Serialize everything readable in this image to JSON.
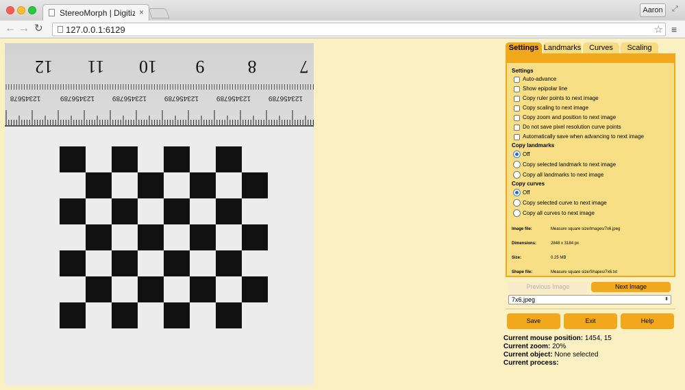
{
  "browser": {
    "tab_title": "StereoMorph | Digitizing A",
    "tab_close": "×",
    "user_label": "Aaron",
    "url": "127.0.0.1:6129",
    "back_glyph": "←",
    "forward_glyph": "→",
    "reload_glyph": "↻",
    "star_glyph": "☆",
    "menu_glyph": "≡",
    "fullscreen_glyph": "⤢"
  },
  "ruler": {
    "numbers": [
      "12",
      "11",
      "10",
      "9",
      "8",
      "7"
    ],
    "fine_labels": [
      "12345678",
      "123456789",
      "123456789",
      "123456789",
      "123456789",
      "123456789",
      "89"
    ]
  },
  "tabs": [
    {
      "label": "Settings",
      "active": true
    },
    {
      "label": "Landmarks",
      "active": false
    },
    {
      "label": "Curves",
      "active": false
    },
    {
      "label": "Scaling",
      "active": false
    }
  ],
  "settings": {
    "title": "Settings",
    "checkboxes": [
      "Auto-advance",
      "Show epipolar line",
      "Copy ruler points to next image",
      "Copy scaling to next image",
      "Copy zoom and position to next image",
      "Do not save pixel resolution curve points",
      "Automatically save when advancing to next image"
    ],
    "copy_landmarks_title": "Copy landmarks",
    "copy_landmarks": [
      {
        "label": "Off",
        "selected": true
      },
      {
        "label": "Copy selected landmark to next image",
        "selected": false
      },
      {
        "label": "Copy all landmarks to next image",
        "selected": false
      }
    ],
    "copy_curves_title": "Copy curves",
    "copy_curves": [
      {
        "label": "Off",
        "selected": true
      },
      {
        "label": "Copy selected curve to next image",
        "selected": false
      },
      {
        "label": "Copy all curves to next image",
        "selected": false
      }
    ],
    "info": {
      "image_file_label": "Image file:",
      "image_file_value": "Measure square size/Images/7x6.jpeg",
      "dimensions_label": "Dimensions:",
      "dimensions_value": "2848 x 3184 px",
      "size_label": "Size:",
      "size_value": "0.25 MB",
      "shape_file_label": "Shape file:",
      "shape_file_value": "Measure square size/Shapes/7x6.txt"
    }
  },
  "navigation": {
    "previous_label": "Previous Image",
    "next_label": "Next Image",
    "selected_image": "7x6.jpeg",
    "select_arrow": "⬍"
  },
  "actions": {
    "save_label": "Save",
    "exit_label": "Exit",
    "help_label": "Help"
  },
  "status": {
    "mouse_label": "Current mouse position:",
    "mouse_value": " 1454, 15",
    "zoom_label": "Current zoom:",
    "zoom_value": " 20%",
    "object_label": "Current object:",
    "object_value": " None selected",
    "process_label": "Current process:",
    "process_value": ""
  },
  "colors": {
    "page_background": "#fbf0c2",
    "accent": "#f2a81c",
    "panel": "#f8df86"
  }
}
